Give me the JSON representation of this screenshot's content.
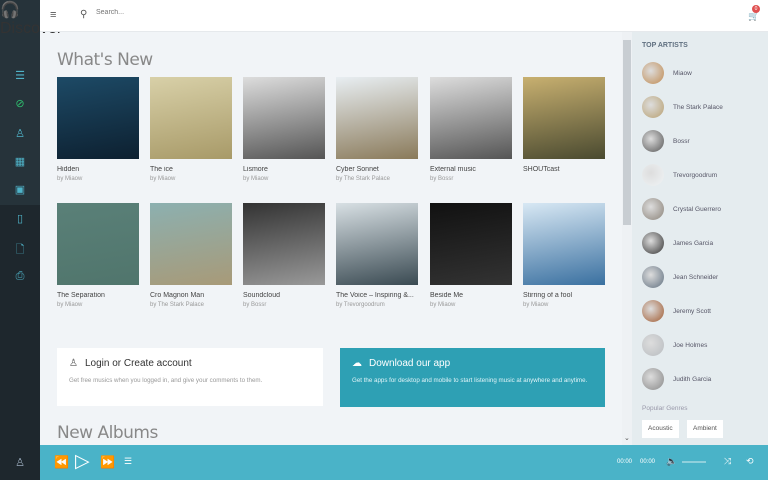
{
  "sidebar": {
    "logo_icon": "headphones-icon",
    "discover": "Discover",
    "items": [
      "list-icon",
      "genre-icon",
      "artist-icon",
      "grid-icon",
      "video-icon",
      "book-icon",
      "file-icon",
      "bag-icon"
    ],
    "bottom_icon": "user-icon"
  },
  "header": {
    "search_placeholder": "Search...",
    "cart_count": "0"
  },
  "whats_new": {
    "title": "What's New",
    "items": [
      {
        "title": "Hidden",
        "artist": "by Miaow",
        "c1": "#1d4a66",
        "c2": "#0d2030"
      },
      {
        "title": "The ice",
        "artist": "by Miaow",
        "c1": "#d8d0a8",
        "c2": "#a89a68"
      },
      {
        "title": "Lismore",
        "artist": "by Miaow",
        "c1": "#ddd",
        "c2": "#555"
      },
      {
        "title": "Cyber Sonnet",
        "artist": "by The Stark Palace",
        "c1": "#e8eef2",
        "c2": "#8a7a5a"
      },
      {
        "title": "External music",
        "artist": "by Bossr",
        "c1": "#ddd",
        "c2": "#555"
      },
      {
        "title": "SHOUTcast",
        "artist": "",
        "c1": "#c8b070",
        "c2": "#4a4a30"
      },
      {
        "title": "The Separation",
        "artist": "by Miaow",
        "c1": "#5a8078",
        "c2": "#50756c"
      },
      {
        "title": "Cro Magnon Man",
        "artist": "by The Stark Palace",
        "c1": "#8cb0b0",
        "c2": "#a89a78"
      },
      {
        "title": "Soundcloud",
        "artist": "by Bossr",
        "c1": "#333",
        "c2": "#999"
      },
      {
        "title": "The Voice – Inspiring &...",
        "artist": "by Trevorgoodrum",
        "c1": "#d8e0e4",
        "c2": "#3a4a52"
      },
      {
        "title": "Beside Me",
        "artist": "by Miaow",
        "c1": "#111",
        "c2": "#333"
      },
      {
        "title": "Stirring of a fool",
        "artist": "by Miaow",
        "c1": "#d8e8f4",
        "c2": "#3a70a0"
      }
    ]
  },
  "login": {
    "title": "Login or Create account",
    "text": "Get free musics when you logged in, and give your comments to them."
  },
  "download": {
    "title": "Download our app",
    "text": "Get the apps for desktop and mobile to start listening music at anywhere and anytime."
  },
  "new_albums": {
    "title": "New Albums"
  },
  "top_artists": {
    "title": "TOP ARTISTS",
    "items": [
      {
        "name": "Miaow",
        "color": "#c08a50"
      },
      {
        "name": "The Stark Palace",
        "color": "#b8a070"
      },
      {
        "name": "Bossr",
        "color": "#555"
      },
      {
        "name": "Trevorgoodrum",
        "color": "#f0f4f6"
      },
      {
        "name": "Crystal Guerrero",
        "color": "#8a8278"
      },
      {
        "name": "James Garcia",
        "color": "#333"
      },
      {
        "name": "Jean Schneider",
        "color": "#607080"
      },
      {
        "name": "Jeremy Scott",
        "color": "#a05a30"
      },
      {
        "name": "Joe Holmes",
        "color": "#b8bcc0"
      },
      {
        "name": "Judith Garcia",
        "color": "#888"
      }
    ]
  },
  "genres": {
    "title": "Popular Genres",
    "items": [
      "Acoustic",
      "Ambient"
    ]
  },
  "player": {
    "time_current": "00:00",
    "time_total": "00:00"
  },
  "colors": {
    "accent": "#4ab3c8",
    "download_bg": "#2ea0b4"
  }
}
